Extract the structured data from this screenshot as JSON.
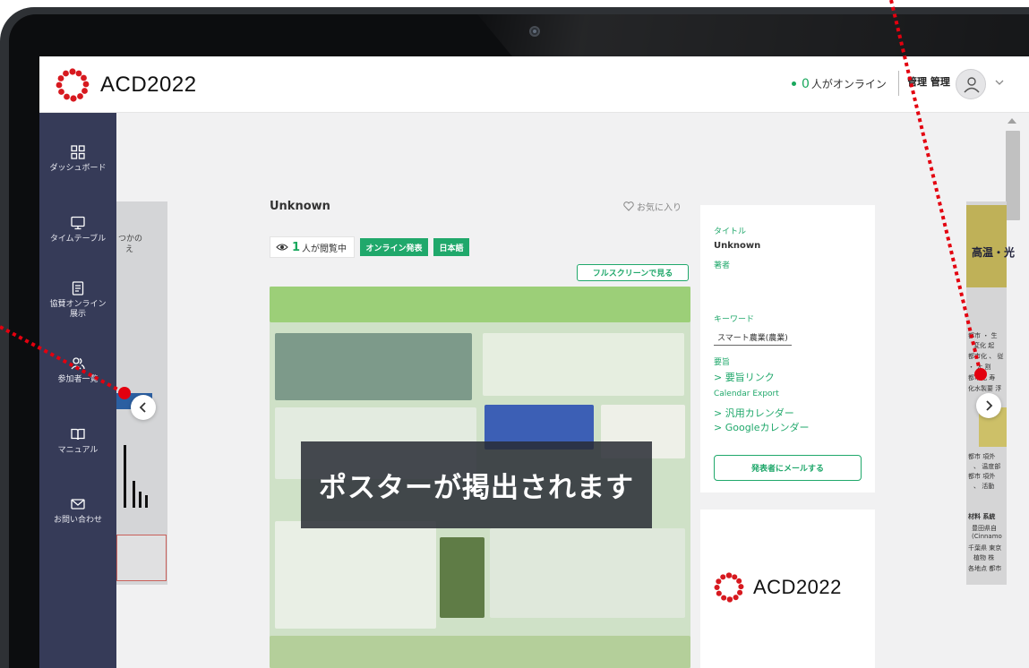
{
  "header": {
    "logo_text": "ACD2022",
    "online_count": "0",
    "online_text": "人がオンライン",
    "user_name": "管理 管理"
  },
  "sidebar": {
    "items": [
      {
        "label": "ダッシュボード",
        "icon": "dashboard-grid-icon"
      },
      {
        "label": "タイムテーブル",
        "icon": "monitor-icon"
      },
      {
        "label": "協賛オンライン\n展示",
        "icon": "document-icon"
      },
      {
        "label": "参加者一覧",
        "icon": "people-icon"
      },
      {
        "label": "マニュアル",
        "icon": "book-icon"
      },
      {
        "label": "お問い合わせ",
        "icon": "mail-icon"
      }
    ]
  },
  "carousel": {
    "left_slide_text": "つかの",
    "left_slide_sub": "え",
    "right_slide_title": "高温・光",
    "right_slide_lines": [
      "都市 ・ 生",
      "変化 起",
      "都市化 、 従",
      "・ 大 割",
      "都市化 寿",
      "化水製要 浮",
      "都市 項外",
      "、 温度部",
      "都市 項外",
      "、 活動",
      "材料 系統",
      "豊田県自",
      "(Cinnamo",
      "千葉県 東京",
      "植物 株",
      "各地点 都市"
    ]
  },
  "poster": {
    "title": "Unknown",
    "favorite_label": "お気に入り",
    "viewers_count": "1",
    "viewers_text": "人が閲覧中",
    "tags": [
      "オンライン発表",
      "日本語"
    ],
    "fullscreen_label": "フルスクリーンで見る",
    "overlay_text": "ポスターが掲出されます"
  },
  "info": {
    "title_label": "タイトル",
    "title_value": "Unknown",
    "author_label": "著者",
    "keyword_label": "キーワード",
    "keyword": "スマート農業(農業)",
    "abstract_label": "要旨",
    "abstract_link": "> 要旨リンク",
    "calendar_label": "Calendar Export",
    "calendar_general": "> 汎用カレンダー",
    "calendar_google": "> Googleカレンダー",
    "mail_button": "発表者にメールする"
  },
  "sponsor": {
    "logo_text": "ACD2022"
  },
  "colors": {
    "accent": "#20a86b",
    "sidebar": "#363b58",
    "annotation": "#e3000f"
  }
}
